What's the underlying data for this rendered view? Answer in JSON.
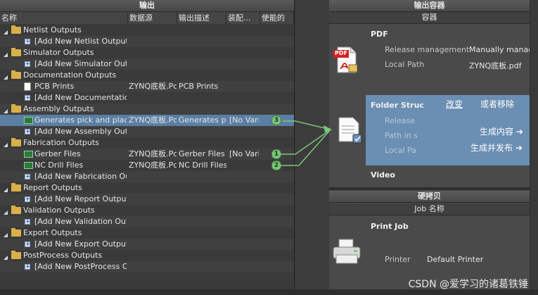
{
  "left_panel": {
    "title": "输出",
    "columns": [
      "名称",
      "数据源",
      "输出描述",
      "装配...",
      "使能的"
    ],
    "rows": [
      {
        "kind": "group",
        "label": "Netlist Outputs"
      },
      {
        "kind": "add",
        "label": "[Add New Netlist Output]"
      },
      {
        "kind": "group",
        "label": "Simulator Outputs"
      },
      {
        "kind": "add",
        "label": "[Add New Simulator Outpu"
      },
      {
        "kind": "group",
        "label": "Documentation Outputs"
      },
      {
        "kind": "doc",
        "label": "PCB Prints",
        "source": "ZYNQ底板.Pc",
        "desc": "PCB Prints"
      },
      {
        "kind": "add",
        "label": "[Add New Documentation"
      },
      {
        "kind": "group",
        "label": "Assembly Outputs"
      },
      {
        "kind": "chip",
        "label": "Generates pick and place",
        "source": "ZYNQ底板.Pc",
        "desc": "Generates pic",
        "variant": "[No Vari",
        "badge": "3",
        "selected": true
      },
      {
        "kind": "add",
        "label": "[Add New Assembly Outp"
      },
      {
        "kind": "group",
        "label": "Fabrication Outputs"
      },
      {
        "kind": "chip",
        "label": "Gerber Files",
        "source": "ZYNQ底板.Pc",
        "desc": "Gerber Files",
        "variant": "[No Vari",
        "badge": "1"
      },
      {
        "kind": "chip",
        "label": "NC Drill Files",
        "source": "ZYNQ底板.Pc",
        "desc": "NC Drill Files",
        "badge": "2"
      },
      {
        "kind": "add",
        "label": "[Add New Fabrication Ou"
      },
      {
        "kind": "group",
        "label": "Report Outputs"
      },
      {
        "kind": "add",
        "label": "[Add New Report Output]"
      },
      {
        "kind": "group",
        "label": "Validation Outputs"
      },
      {
        "kind": "add",
        "label": "[Add New Validation Outp"
      },
      {
        "kind": "group",
        "label": "Export Outputs"
      },
      {
        "kind": "add",
        "label": "[Add New Export Output]"
      },
      {
        "kind": "group",
        "label": "PostProcess Outputs"
      },
      {
        "kind": "add",
        "label": "[Add New PostProcess Ou"
      }
    ]
  },
  "right_panel": {
    "title": "输出容器",
    "subtitle": "容器",
    "pdf": {
      "name": "PDF",
      "release_label": "Release management",
      "release_value": "Manually manag",
      "path_label": "Local Path",
      "path_value": "ZYNQ底板.pdf",
      "icon_text": "PDF"
    },
    "folder": {
      "name": "Folder Struc",
      "change": "改变",
      "or_remove": "或者移除",
      "release_label": "Release",
      "path_label": "Path in s",
      "local_label": "Local Pa",
      "gen_content": "生成内容 ➔",
      "gen_publish": "生成并发布 ➔"
    },
    "video": {
      "name": "Video"
    },
    "hardcopy_title": "硬拷贝",
    "job_header": "Job 名称",
    "print_job": {
      "name": "Print Job",
      "printer_label": "Printer",
      "printer_value": "Default Printer"
    }
  },
  "watermark": "CSDN @爱学习的诸葛铁锤",
  "colors": {
    "selection": "#5b7fa4",
    "connector": "#7cc47c",
    "folder_card": "#6b8eb3"
  }
}
